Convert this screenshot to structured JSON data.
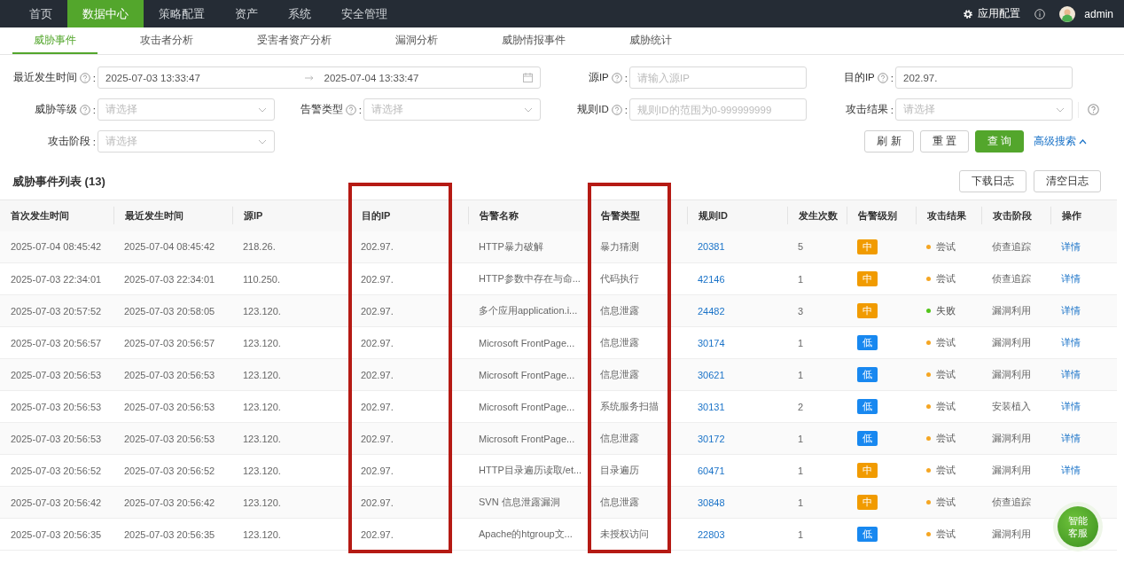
{
  "top_nav": {
    "items": [
      {
        "label": "首页",
        "selected": false
      },
      {
        "label": "数据中心",
        "selected": true
      },
      {
        "label": "策略配置",
        "selected": false
      },
      {
        "label": "资产",
        "selected": false
      },
      {
        "label": "系统",
        "selected": false
      },
      {
        "label": "安全管理",
        "selected": false
      }
    ],
    "app_config": "应用配置",
    "user": "admin"
  },
  "tabs": [
    {
      "label": "威胁事件",
      "selected": true
    },
    {
      "label": "攻击者分析",
      "selected": false
    },
    {
      "label": "受害者资产分析",
      "selected": false
    },
    {
      "label": "漏洞分析",
      "selected": false
    },
    {
      "label": "威胁情报事件",
      "selected": false
    },
    {
      "label": "威胁统计",
      "selected": false
    }
  ],
  "filters": {
    "time": {
      "label": "最近发生时间",
      "start": "2025-07-03 13:33:47",
      "end": "2025-07-04 13:33:47"
    },
    "source_ip": {
      "label": "源IP",
      "placeholder": "请输入源IP"
    },
    "dest_ip": {
      "label": "目的IP",
      "value": "202.97."
    },
    "threat_level": {
      "label": "威胁等级",
      "placeholder": "请选择"
    },
    "alert_type": {
      "label": "告警类型",
      "placeholder": "请选择"
    },
    "rule_id": {
      "label": "规则ID",
      "placeholder": "规则ID的范围为0-999999999"
    },
    "attack_result": {
      "label": "攻击结果",
      "placeholder": "请选择"
    },
    "attack_stage": {
      "label": "攻击阶段",
      "placeholder": "请选择"
    },
    "buttons": [
      {
        "label": "刷 新",
        "kind": "default"
      },
      {
        "label": "重 置",
        "kind": "default"
      },
      {
        "label": "查 询",
        "kind": "primary"
      }
    ],
    "advanced": "高级搜索",
    "label_suffix": ":"
  },
  "table": {
    "title": "威胁事件列表 (13)",
    "actions": [
      "下载日志",
      "清空日志"
    ],
    "columns": [
      {
        "label": "首次发生时间",
        "highlighted": false
      },
      {
        "label": "最近发生时间",
        "highlighted": false
      },
      {
        "label": "源IP",
        "highlighted": false
      },
      {
        "label": "目的IP",
        "highlighted": true
      },
      {
        "label": "告警名称",
        "highlighted": false
      },
      {
        "label": "告警类型",
        "highlighted": true
      },
      {
        "label": "规则ID",
        "highlighted": false
      },
      {
        "label": "发生次数",
        "highlighted": false
      },
      {
        "label": "告警级别",
        "highlighted": false
      },
      {
        "label": "攻击结果",
        "highlighted": false
      },
      {
        "label": "攻击阶段",
        "highlighted": false
      },
      {
        "label": "操作",
        "highlighted": false
      }
    ],
    "rows": [
      {
        "first": "2025-07-04 08:45:42",
        "last": "2025-07-04 08:45:42",
        "src": "218.26.",
        "dst": "202.97.",
        "name": "HTTP暴力破解",
        "type": "暴力猜测",
        "rule": "20381",
        "count": "5",
        "severity": {
          "label": "中",
          "kind": "medium"
        },
        "result": {
          "label": "尝试",
          "color": "#f5a623"
        },
        "stage": "侦查追踪",
        "action": "详情"
      },
      {
        "first": "2025-07-03 22:34:01",
        "last": "2025-07-03 22:34:01",
        "src": "110.250.",
        "dst": "202.97.",
        "name": "HTTP参数中存在与命...",
        "type": "代码执行",
        "rule": "42146",
        "count": "1",
        "severity": {
          "label": "中",
          "kind": "medium"
        },
        "result": {
          "label": "尝试",
          "color": "#f5a623"
        },
        "stage": "侦查追踪",
        "action": "详情"
      },
      {
        "first": "2025-07-03 20:57:52",
        "last": "2025-07-03 20:58:05",
        "src": "123.120.",
        "dst": "202.97.",
        "name": "多个应用application.i...",
        "type": "信息泄露",
        "rule": "24482",
        "count": "3",
        "severity": {
          "label": "中",
          "kind": "medium"
        },
        "result": {
          "label": "失败",
          "color": "#52c41a"
        },
        "stage": "漏洞利用",
        "action": "详情"
      },
      {
        "first": "2025-07-03 20:56:57",
        "last": "2025-07-03 20:56:57",
        "src": "123.120.",
        "dst": "202.97.",
        "name": "Microsoft FrontPage...",
        "type": "信息泄露",
        "rule": "30174",
        "count": "1",
        "severity": {
          "label": "低",
          "kind": "low"
        },
        "result": {
          "label": "尝试",
          "color": "#f5a623"
        },
        "stage": "漏洞利用",
        "action": "详情"
      },
      {
        "first": "2025-07-03 20:56:53",
        "last": "2025-07-03 20:56:53",
        "src": "123.120.",
        "dst": "202.97.",
        "name": "Microsoft FrontPage...",
        "type": "信息泄露",
        "rule": "30621",
        "count": "1",
        "severity": {
          "label": "低",
          "kind": "low"
        },
        "result": {
          "label": "尝试",
          "color": "#f5a623"
        },
        "stage": "漏洞利用",
        "action": "详情"
      },
      {
        "first": "2025-07-03 20:56:53",
        "last": "2025-07-03 20:56:53",
        "src": "123.120.",
        "dst": "202.97.",
        "name": "Microsoft FrontPage...",
        "type": "系统服务扫描",
        "rule": "30131",
        "count": "2",
        "severity": {
          "label": "低",
          "kind": "low"
        },
        "result": {
          "label": "尝试",
          "color": "#f5a623"
        },
        "stage": "安装植入",
        "action": "详情"
      },
      {
        "first": "2025-07-03 20:56:53",
        "last": "2025-07-03 20:56:53",
        "src": "123.120.",
        "dst": "202.97.",
        "name": "Microsoft FrontPage...",
        "type": "信息泄露",
        "rule": "30172",
        "count": "1",
        "severity": {
          "label": "低",
          "kind": "low"
        },
        "result": {
          "label": "尝试",
          "color": "#f5a623"
        },
        "stage": "漏洞利用",
        "action": "详情"
      },
      {
        "first": "2025-07-03 20:56:52",
        "last": "2025-07-03 20:56:52",
        "src": "123.120.",
        "dst": "202.97.",
        "name": "HTTP目录遍历读取/et...",
        "type": "目录遍历",
        "rule": "60471",
        "count": "1",
        "severity": {
          "label": "中",
          "kind": "medium"
        },
        "result": {
          "label": "尝试",
          "color": "#f5a623"
        },
        "stage": "漏洞利用",
        "action": "详情"
      },
      {
        "first": "2025-07-03 20:56:42",
        "last": "2025-07-03 20:56:42",
        "src": "123.120.",
        "dst": "202.97.",
        "name": "SVN 信息泄露漏洞",
        "type": "信息泄露",
        "rule": "30848",
        "count": "1",
        "severity": {
          "label": "中",
          "kind": "medium"
        },
        "result": {
          "label": "尝试",
          "color": "#f5a623"
        },
        "stage": "侦查追踪"
      },
      {
        "first": "2025-07-03 20:56:35",
        "last": "2025-07-03 20:56:35",
        "src": "123.120.",
        "dst": "202.97.",
        "name": "Apache的htgroup文...",
        "type": "未授权访问",
        "rule": "22803",
        "count": "1",
        "severity": {
          "label": "低",
          "kind": "low"
        },
        "result": {
          "label": "尝试",
          "color": "#f5a623"
        },
        "stage": "漏洞利用"
      }
    ]
  },
  "assistant_button": "智能客服"
}
